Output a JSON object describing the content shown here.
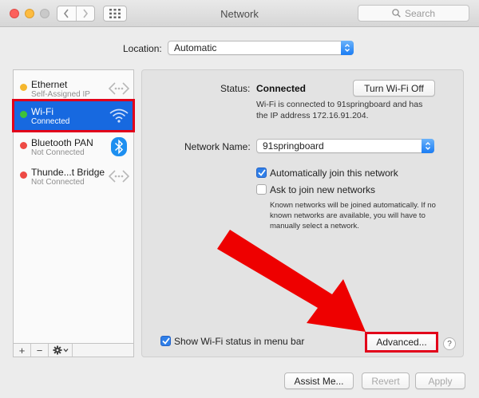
{
  "window": {
    "title": "Network"
  },
  "toolbar": {
    "back_icon": "chevron-left-icon",
    "forward_icon": "chevron-right-icon",
    "grid_icon": "show-all-grid-icon",
    "search_placeholder": "Search"
  },
  "location": {
    "label": "Location:",
    "value": "Automatic"
  },
  "services": [
    {
      "name": "Ethernet",
      "status": "Self-Assigned IP",
      "dot_color": "#f5b72e",
      "icon": "ethernet-arrows-icon",
      "selected": false
    },
    {
      "name": "Wi-Fi",
      "status": "Connected",
      "dot_color": "#3ec23b",
      "icon": "wifi-icon",
      "selected": true
    },
    {
      "name": "Bluetooth PAN",
      "status": "Not Connected",
      "dot_color": "#ee4a45",
      "icon": "bluetooth-icon",
      "selected": false
    },
    {
      "name": "Thunde...t Bridge",
      "status": "Not Connected",
      "dot_color": "#ee4a45",
      "icon": "bridge-arrows-icon",
      "selected": false
    }
  ],
  "sidebar_footer": {
    "add": "+",
    "remove": "−"
  },
  "detail": {
    "status_label": "Status:",
    "status_value": "Connected",
    "turn_off_button": "Turn Wi-Fi Off",
    "status_description": "Wi-Fi is connected to 91springboard and has the IP address 172.16.91.204.",
    "network_name_label": "Network Name:",
    "network_name_value": "91springboard",
    "auto_join_label": "Automatically join this network",
    "auto_join_checked": true,
    "ask_join_label": "Ask to join new networks",
    "ask_join_checked": false,
    "known_networks_note": "Known networks will be joined automatically. If no known networks are available, you will have to manually select a network.",
    "show_status_label": "Show Wi-Fi status in menu bar",
    "show_status_checked": true,
    "advanced_button": "Advanced...",
    "help_button": "?"
  },
  "footer": {
    "assist_button": "Assist Me...",
    "revert_button": "Revert",
    "apply_button": "Apply"
  },
  "annotation": {
    "arrow_color": "#ee0000",
    "highlight_color": "#e2001a"
  }
}
